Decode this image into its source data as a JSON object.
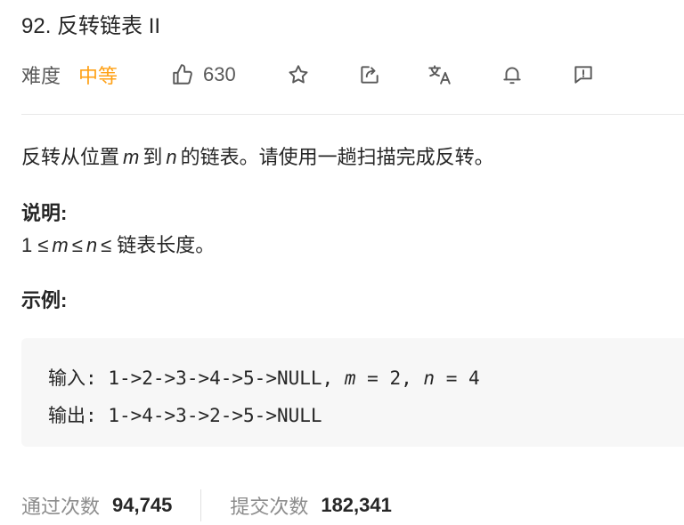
{
  "problem": {
    "title": "92. 反转链表 II"
  },
  "meta": {
    "difficulty_label": "难度",
    "difficulty_value": "中等",
    "difficulty_color": "#ffa116",
    "likes": "630",
    "icons": [
      "thumbs-up-icon",
      "star-icon",
      "share-icon",
      "translate-icon",
      "bell-icon",
      "feedback-icon"
    ]
  },
  "description": {
    "part1": "反转从位置",
    "m": "m",
    "part2": "到",
    "n": "n",
    "part3": "的链表。请使用一趟扫描完成反转。"
  },
  "note": {
    "heading": "说明:",
    "prefix": "1 ≤",
    "m": "m",
    "middle": "≤",
    "n": "n",
    "suffix": "≤ 链表长度。"
  },
  "example": {
    "heading": "示例:",
    "input_label": "输入:",
    "input_value": "1->2->3->4->5->NULL,",
    "input_m": "m",
    "input_m_eq": "= 2,",
    "input_n": "n",
    "input_n_eq": "= 4",
    "output_label": "输出:",
    "output_value": "1->4->3->2->5->NULL"
  },
  "stats": {
    "accepted_label": "通过次数",
    "accepted_value": "94,745",
    "submissions_label": "提交次数",
    "submissions_value": "182,341"
  }
}
